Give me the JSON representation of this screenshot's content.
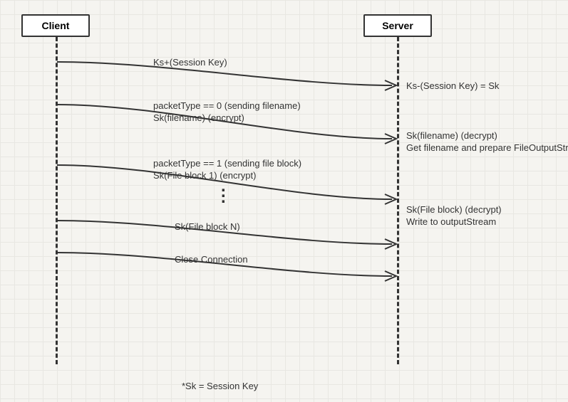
{
  "actors": {
    "client": "Client",
    "server": "Server"
  },
  "messages": {
    "m1": "Ks+(Session Key)",
    "m2a": "packetType == 0 (sending filename)",
    "m2b": "Sk(filename) (encrypt)",
    "m3a": "packetType == 1 (sending file block)",
    "m3b": "Sk(File block 1) (encrypt)",
    "m4": "Sk(File block N)",
    "m5": "Close Connection"
  },
  "notes": {
    "n1": "Ks-(Session Key) = Sk",
    "n2a": "Sk(filename) (decrypt)",
    "n2b": "Get filename and prepare FileOutputStream",
    "n3a": "Sk(File block) (decrypt)",
    "n3b": "Write to outputStream"
  },
  "footnote": "*Sk = Session Key",
  "chart_data": {
    "type": "sequence-diagram",
    "actors": [
      "Client",
      "Server"
    ],
    "interactions": [
      {
        "from": "Client",
        "to": "Server",
        "label": "Ks+(Session Key)",
        "server_note": "Ks-(Session Key) = Sk"
      },
      {
        "from": "Client",
        "to": "Server",
        "label": "packetType == 0 (sending filename); Sk(filename) (encrypt)",
        "server_note": "Sk(filename) (decrypt); Get filename and prepare FileOutputStream"
      },
      {
        "from": "Client",
        "to": "Server",
        "label": "packetType == 1 (sending file block); Sk(File block 1) (encrypt)",
        "server_note": "Sk(File block) (decrypt); Write to outputStream"
      },
      {
        "from": "Client",
        "to": "Server",
        "label": "Sk(File block N)"
      },
      {
        "from": "Client",
        "to": "Server",
        "label": "Close Connection"
      }
    ],
    "footnote": "*Sk = Session Key"
  }
}
